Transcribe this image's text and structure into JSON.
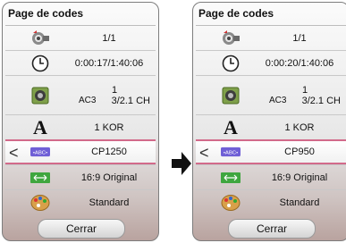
{
  "left": {
    "title": "Page de codes",
    "angle": "1/1",
    "time": "0:00:17/1:40:06",
    "audio": {
      "track": "1",
      "codec": "AC3",
      "channels": "3/2.1 CH"
    },
    "subtitle_lang": "1 KOR",
    "code_page": "CP1250",
    "aspect": "16:9 Original",
    "picture_mode": "Standard",
    "close_label": "Cerrar"
  },
  "right": {
    "title": "Page de codes",
    "angle": "1/1",
    "time": "0:00:20/1:40:06",
    "audio": {
      "track": "1",
      "codec": "AC3",
      "channels": "3/2.1 CH"
    },
    "subtitle_lang": "1 KOR",
    "code_page": "CP950",
    "aspect": "16:9 Original",
    "picture_mode": "Standard",
    "close_label": "Cerrar"
  },
  "chevron": "<",
  "icons": [
    "camera-angle-icon",
    "clock-icon",
    "speaker-icon",
    "subtitle-letter-icon",
    "abc-code-icon",
    "aspect-arrow-icon",
    "palette-icon",
    "right-arrow-icon"
  ],
  "colors": {
    "highlight": "#d26a8a",
    "abc_badge": "#6f5fd6",
    "aspect_badge": "#3fa63f"
  }
}
